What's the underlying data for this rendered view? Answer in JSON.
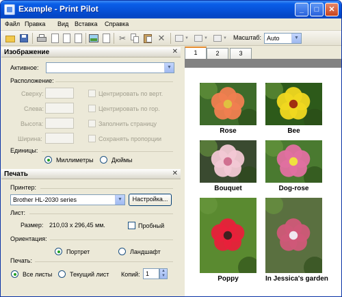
{
  "window": {
    "title": "Example - Print Pilot"
  },
  "menu": [
    "Файл",
    "Правка",
    "Вид",
    "Вставка",
    "Справка"
  ],
  "toolbar": {
    "zoom_label": "Масштаб:",
    "zoom_value": "Auto"
  },
  "image_panel": {
    "title": "Изображение",
    "active_label": "Активное:",
    "active_value": "",
    "layout_label": "Расположение:",
    "top_label": "Сверху:",
    "left_label": "Слева:",
    "height_label": "Высота:",
    "width_label": "Ширина:",
    "center_vert": "Центрировать по верт.",
    "center_horiz": "Центрировать по гор.",
    "fill_page": "Заполнить страницу",
    "keep_ratio": "Сохранять пропорции",
    "units_label": "Единицы:",
    "unit_mm": "Миллиметры",
    "unit_inch": "Дюймы",
    "unit_selected": "mm"
  },
  "print_panel": {
    "title": "Печать",
    "printer_label": "Принтер:",
    "printer_value": "Brother HL-2030 series",
    "setup_button": "Настройка...",
    "sheet_label": "Лист:",
    "size_label": "Размер:",
    "size_value": "210,03 x 296,45 мм.",
    "trial_label": "Пробный",
    "orientation_label": "Ориентация:",
    "portrait": "Портрет",
    "landscape": "Ландшафт",
    "orientation_selected": "portrait",
    "print_label": "Печать:",
    "all_sheets": "Все листы",
    "current_sheet": "Текущий лист",
    "copies_label": "Копий:",
    "copies_value": "1",
    "print_selected": "all"
  },
  "tabs": [
    "1",
    "2",
    "3"
  ],
  "photos": [
    {
      "caption": "Rose",
      "colors": {
        "bg": "#3e6b2a",
        "flower": "#f08050",
        "center": "#e0c040"
      }
    },
    {
      "caption": "Bee",
      "colors": {
        "bg": "#2d5a1a",
        "flower": "#f0d820",
        "center": "#a03010"
      }
    },
    {
      "caption": "Bouquet",
      "colors": {
        "bg": "#3a4a30",
        "flower": "#f2c8d4",
        "center": "#d07090"
      }
    },
    {
      "caption": "Dog-rose",
      "colors": {
        "bg": "#4a7a30",
        "flower": "#e070a0",
        "center": "#f0e040"
      }
    },
    {
      "caption": "Poppy",
      "colors": {
        "bg": "#5a8a30",
        "flower": "#e8203a",
        "center": "#402020"
      }
    },
    {
      "caption": "In Jessica's garden",
      "colors": {
        "bg": "#5a7040",
        "flower": "#d05878",
        "center": "#f0e8f0"
      }
    }
  ]
}
